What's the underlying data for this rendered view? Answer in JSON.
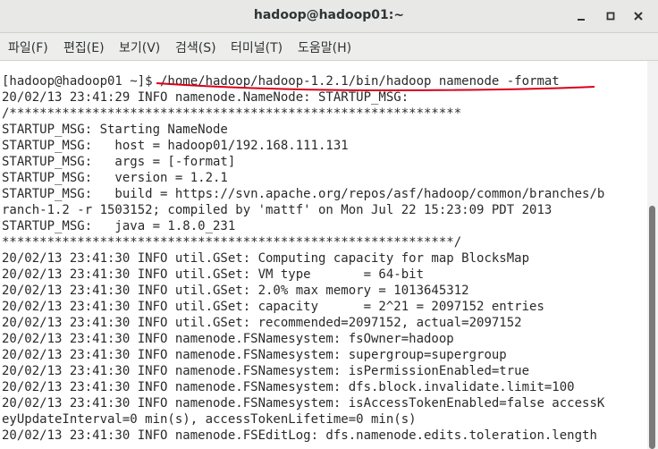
{
  "window": {
    "title": "hadoop@hadoop01:~"
  },
  "icons": {
    "minimize": "minimize-icon",
    "maximize": "maximize-icon",
    "close": "close-icon"
  },
  "menu": [
    "파일(F)",
    "편집(E)",
    "보기(V)",
    "검색(S)",
    "터미널(T)",
    "도움말(H)"
  ],
  "terminal": {
    "lines": [
      "[hadoop@hadoop01 ~]$ /home/hadoop/hadoop-1.2.1/bin/hadoop namenode -format",
      "20/02/13 23:41:29 INFO namenode.NameNode: STARTUP_MSG:",
      "/************************************************************",
      "STARTUP_MSG: Starting NameNode",
      "STARTUP_MSG:   host = hadoop01/192.168.111.131",
      "STARTUP_MSG:   args = [-format]",
      "STARTUP_MSG:   version = 1.2.1",
      "STARTUP_MSG:   build = https://svn.apache.org/repos/asf/hadoop/common/branches/b",
      "ranch-1.2 -r 1503152; compiled by 'mattf' on Mon Jul 22 15:23:09 PDT 2013",
      "STARTUP_MSG:   java = 1.8.0_231",
      "************************************************************/",
      "20/02/13 23:41:30 INFO util.GSet: Computing capacity for map BlocksMap",
      "20/02/13 23:41:30 INFO util.GSet: VM type       = 64-bit",
      "20/02/13 23:41:30 INFO util.GSet: 2.0% max memory = 1013645312",
      "20/02/13 23:41:30 INFO util.GSet: capacity      = 2^21 = 2097152 entries",
      "20/02/13 23:41:30 INFO util.GSet: recommended=2097152, actual=2097152",
      "20/02/13 23:41:30 INFO namenode.FSNamesystem: fsOwner=hadoop",
      "20/02/13 23:41:30 INFO namenode.FSNamesystem: supergroup=supergroup",
      "20/02/13 23:41:30 INFO namenode.FSNamesystem: isPermissionEnabled=true",
      "20/02/13 23:41:30 INFO namenode.FSNamesystem: dfs.block.invalidate.limit=100",
      "20/02/13 23:41:30 INFO namenode.FSNamesystem: isAccessTokenEnabled=false accessK",
      "eyUpdateInterval=0 min(s), accessTokenLifetime=0 min(s)",
      "20/02/13 23:41:30 INFO namenode.FSEditLog: dfs.namenode.edits.toleration.length"
    ]
  },
  "colors": {
    "annotation": "#d9001b"
  }
}
